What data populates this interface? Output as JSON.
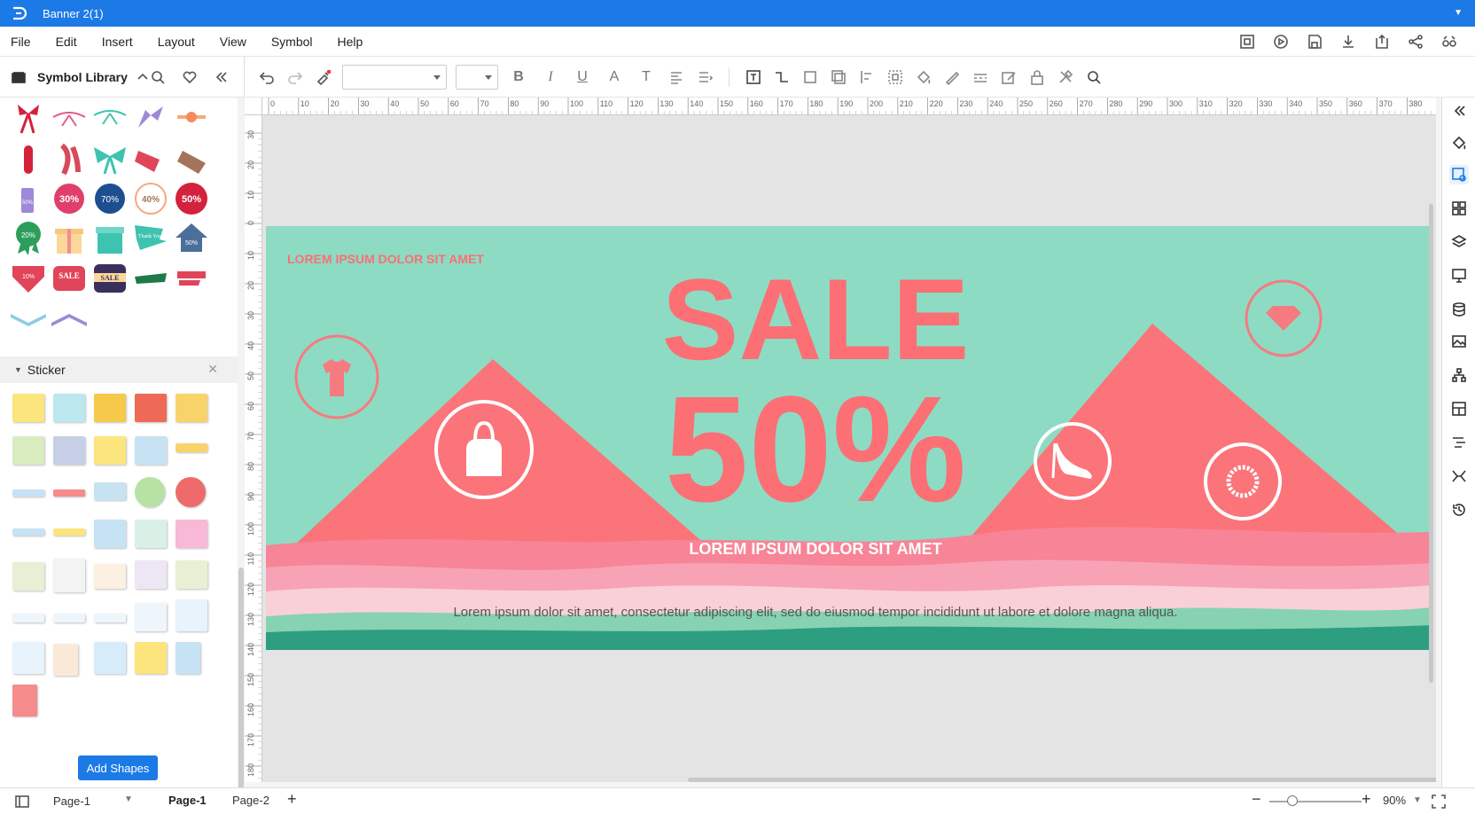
{
  "window": {
    "title": "Banner 2(1)"
  },
  "menu": [
    "File",
    "Edit",
    "Insert",
    "Layout",
    "View",
    "Symbol",
    "Help"
  ],
  "library": {
    "title": "Symbol Library",
    "sections": {
      "sticker": "Sticker"
    },
    "add_shapes_label": "Add Shapes",
    "symbols": {
      "badges": [
        "30%",
        "70%",
        "40%",
        "50%"
      ],
      "ribbon_seal": "20%",
      "tag_label": "50%",
      "sale_tags": [
        "SALE",
        "SALE"
      ],
      "thank_you": "Thank You!",
      "arrows": [
        "50%",
        "10%"
      ]
    }
  },
  "ruler": {
    "top_ticks": [
      "0",
      "10",
      "20",
      "30",
      "40",
      "50",
      "60",
      "70",
      "80",
      "90",
      "100",
      "110",
      "120",
      "130",
      "140",
      "150",
      "160",
      "170",
      "180",
      "190",
      "200",
      "210",
      "220",
      "230",
      "240",
      "250",
      "260",
      "270",
      "280",
      "290",
      "300",
      "310",
      "320",
      "330",
      "340",
      "350",
      "360",
      "370",
      "380"
    ],
    "left_ticks": [
      "30",
      "20",
      "10",
      "0",
      "10",
      "20",
      "30",
      "40",
      "50",
      "60",
      "70",
      "80",
      "90",
      "100",
      "110",
      "120",
      "130",
      "140",
      "150",
      "160",
      "170",
      "180"
    ]
  },
  "banner": {
    "top_label": "LOREM IPSUM DOLOR SIT AMET",
    "sale": "SALE",
    "percent": "50%",
    "subtitle": "LOREM IPSUM DOLOR SIT AMET",
    "body": "Lorem ipsum dolor sit amet, consectetur adipiscing elit, sed do eiusmod tempor incididunt ut labore et dolore magna aliqua.",
    "colors": {
      "background": "#8edbc3",
      "coral": "#fb6f75",
      "circle": "#f57b81",
      "wave_dark": "#2d9e7f"
    }
  },
  "statusbar": {
    "page_selector": "Page-1",
    "tabs": [
      "Page-1",
      "Page-2"
    ],
    "add_page": "+",
    "zoom_minus": "−",
    "zoom_plus": "+",
    "zoom": "90%"
  },
  "colors": {
    "accent": "#1b7ae6"
  }
}
